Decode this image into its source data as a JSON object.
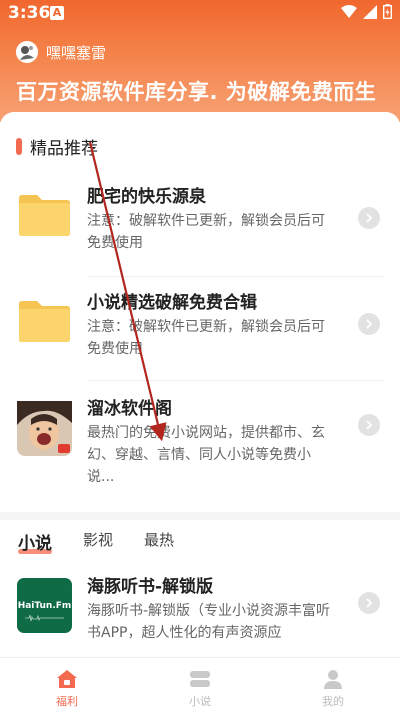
{
  "status": {
    "time": "3:36",
    "notif": "A"
  },
  "header": {
    "username": "嘿嘿塞雷",
    "slogan": "百万资源软件库分享. 为破解免费而生"
  },
  "section": {
    "title": "精品推荐"
  },
  "items": [
    {
      "title": "肥宅的快乐源泉",
      "desc": "注意：破解软件已更新，解锁会员后可免费使用",
      "icon": "folder-icon"
    },
    {
      "title": "小说精选破解免费合辑",
      "desc": "注意：破解软件已更新，解锁会员后可免费使用",
      "icon": "folder-icon"
    },
    {
      "title": "溜冰软件阁",
      "desc": "最热门的免费小说网站，提供都市、玄幻、穿越、言情、同人小说等免费小说...",
      "icon": "app-thumbnail"
    },
    {
      "title": "海豚听书-解锁版",
      "desc": "海豚听书-解锁版（专业小说资源丰富听书APP，超人性化的有声资源应",
      "icon": "haitun-logo",
      "logo_text": "HaiTun.Fm"
    }
  ],
  "tabs": [
    {
      "label": "小说",
      "active": true
    },
    {
      "label": "影视",
      "active": false
    },
    {
      "label": "最热",
      "active": false
    }
  ],
  "nav": [
    {
      "label": "福利",
      "active": true,
      "icon": "home-icon"
    },
    {
      "label": "小说",
      "active": false,
      "icon": "book-icon"
    },
    {
      "label": "我的",
      "active": false,
      "icon": "profile-icon"
    }
  ],
  "colors": {
    "accent": "#f46a4e",
    "header_top": "#f0672e",
    "header_bottom": "#f7a276",
    "folder": "#fbd56c"
  }
}
